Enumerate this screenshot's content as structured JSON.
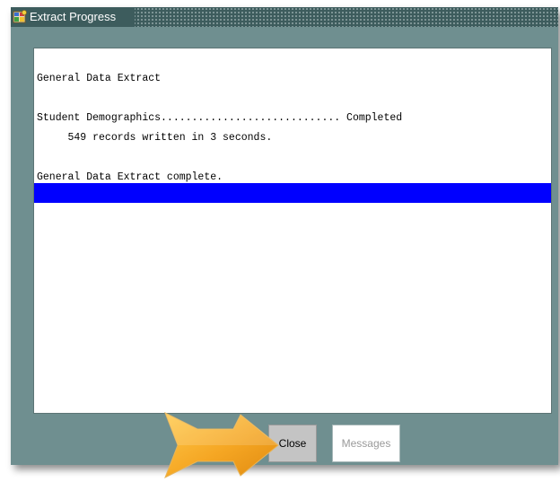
{
  "window": {
    "title": "Extract Progress",
    "colors": {
      "frame": "#6f8f90",
      "titlebar": "#3d5c5d",
      "highlight": "#0000ff",
      "arrow": "#f5a623"
    }
  },
  "log": {
    "lines": [
      "General Data Extract",
      "Student Demographics............................. Completed",
      "     549 records written in 3 seconds.",
      "General Data Extract complete."
    ]
  },
  "buttons": {
    "close_label": "Close",
    "messages_label": "Messages"
  },
  "icons": {
    "app": "app-icon",
    "pointer": "arrow-pointer-icon"
  }
}
